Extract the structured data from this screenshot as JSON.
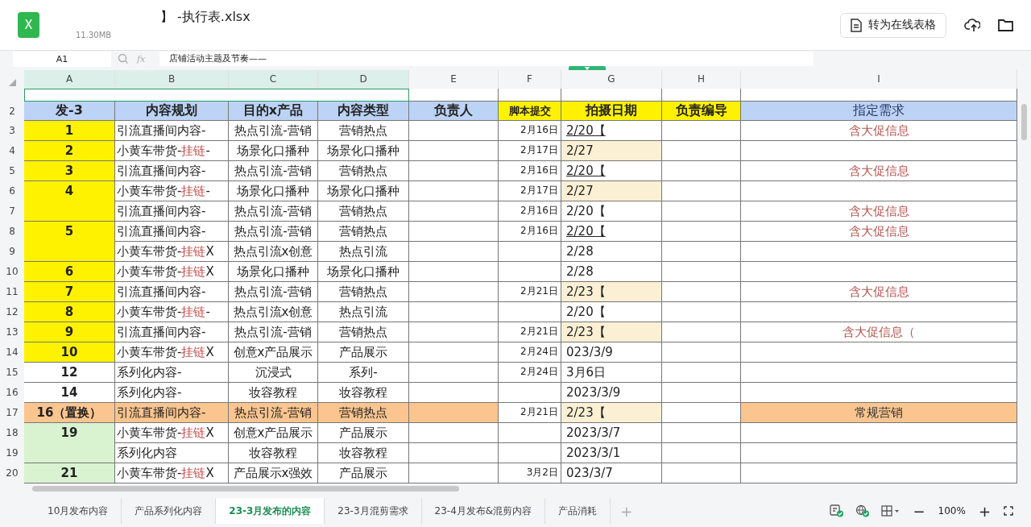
{
  "app_icon_letter": "X",
  "file": {
    "title": "】 -执行表.xlsx",
    "size": "11.30MB"
  },
  "actions": {
    "convert_button": "转为在线表格"
  },
  "formula_bar": {
    "cell_ref": "A1",
    "fx": "fx",
    "formula": "店铺活动主题及节奏——"
  },
  "columns": [
    "A",
    "B",
    "C",
    "D",
    "E",
    "F",
    "G",
    "H",
    "I"
  ],
  "header_row": {
    "number": "2",
    "cells": [
      {
        "text": "发-3",
        "color": "#bcd3f5"
      },
      {
        "text": "内容规划",
        "color": "#bcd3f5"
      },
      {
        "text": "目的x产品",
        "color": "#bcd3f5"
      },
      {
        "text": "内容类型",
        "color": "#bcd3f5"
      },
      {
        "text": "负责人",
        "color": "#bcd3f5"
      },
      {
        "text": "脚本提交",
        "color": "#fff200"
      },
      {
        "text": "拍摄日期",
        "color": "#fff200"
      },
      {
        "text": "负责编导",
        "color": "#fff200"
      },
      {
        "text": "指定需求",
        "color": "#bcd3f5"
      }
    ]
  },
  "rows": [
    {
      "number": "3",
      "a": "1",
      "color": "#fff200",
      "merged": false,
      "b": "引流直播间内容-",
      "c": "热点引流-营销",
      "d": "营销热点",
      "f": "2月16日",
      "g": "2/20【",
      "underlined": true,
      "highlighted": false,
      "i": "含大促信息"
    },
    {
      "number": "4",
      "a": "2",
      "color": "#fff200",
      "merged": false,
      "b": "小黄车带货-",
      "b_link": "挂链",
      "b_end": "-",
      "c": "场景化口播种",
      "d": "场景化口播种",
      "f": "2月17日",
      "g": "2/27",
      "underlined": false,
      "highlighted": true
    },
    {
      "number": "5",
      "a": "3",
      "color": "#fff200",
      "merged": false,
      "b": "引流直播间内容-",
      "c": "热点引流-营销",
      "d": "营销热点",
      "f": "2月16日",
      "g": "2/20【",
      "underlined": true,
      "highlighted": false,
      "i": "含大促信息"
    },
    {
      "number": "6",
      "a": "4",
      "color": "#fff200",
      "merged": true,
      "b": "小黄车带货-",
      "b_link": "挂链",
      "b_end": "-",
      "c": "场景化口播种",
      "d": "场景化口播种",
      "f": "2月17日",
      "g": "2/27",
      "underlined": false,
      "highlighted": true
    },
    {
      "number": "7",
      "b": "引流直播间内容-",
      "c": "热点引流-营销",
      "d": "营销热点",
      "f": "2月16日",
      "g": "2/20【",
      "underlined": false,
      "highlighted": false,
      "i": "含大促信息"
    },
    {
      "number": "8",
      "a": "5",
      "color": "#fff200",
      "merged": true,
      "b": "引流直播间内容-",
      "c": "热点引流-营销",
      "d": "营销热点",
      "f": "2月16日",
      "g": "2/20【",
      "underlined": true,
      "highlighted": false,
      "i": "含大促信息"
    },
    {
      "number": "9",
      "b": "小黄车带货-",
      "b_link": "挂链",
      "b_end": "X",
      "c": "热点引流x创意",
      "d": "热点引流",
      "g": "2/28",
      "underlined": false,
      "highlighted": false
    },
    {
      "number": "10",
      "a": "6",
      "color": "#fff200",
      "merged": false,
      "b": "小黄车带货-",
      "b_link": "挂链",
      "b_end": "X",
      "c": "场景化口播种",
      "d": "场景化口播种",
      "g": "2/28",
      "underlined": false,
      "highlighted": false
    },
    {
      "number": "11",
      "a": "7",
      "color": "#fff200",
      "merged": false,
      "b": "引流直播间内容-",
      "c": "热点引流-营销",
      "d": "营销热点",
      "f": "2月21日",
      "g": "2/23【",
      "underlined": false,
      "highlighted": true,
      "i": "含大促信息"
    },
    {
      "number": "12",
      "a": "8",
      "color": "#fff200",
      "merged": false,
      "b": "小黄车带货-",
      "b_link": "挂链",
      "b_end": "-",
      "c": "热点引流x创意",
      "d": "热点引流",
      "g": "2/20【",
      "underlined": false,
      "highlighted": false
    },
    {
      "number": "13",
      "a": "9",
      "color": "#fff200",
      "merged": false,
      "b": "引流直播间内容-",
      "c": "热点引流-营销",
      "d": "营销热点",
      "f": "2月21日",
      "g": "2/23【",
      "underlined": false,
      "highlighted": true,
      "i": "含大促信息（"
    },
    {
      "number": "14",
      "a": "10",
      "color": "#fff200",
      "merged": false,
      "b": "小黄车带货-",
      "b_link": "挂链",
      "b_end": "X",
      "c": "创意x产品展示",
      "d": "产品展示",
      "f": "2月24日",
      "g": "023/3/9",
      "underlined": false,
      "highlighted": false
    },
    {
      "number": "15",
      "a": "12",
      "color": "#ffffff",
      "merged": false,
      "b": "系列化内容-",
      "c": "沉浸式",
      "d": "系列-",
      "f": "2月24日",
      "g": "3月6日",
      "underlined": false,
      "highlighted": false
    },
    {
      "number": "16",
      "a": "14",
      "color": "#ffffff",
      "merged": false,
      "b": "系列化内容-",
      "c": "妆容教程",
      "d": "妆容教程",
      "g": "2023/3/9",
      "underlined": false,
      "highlighted": false
    },
    {
      "number": "17",
      "a": "16（置换）",
      "color": "#fbc58f",
      "whole_row": true,
      "merged": false,
      "b": "引流直播间内容-",
      "c": "热点引流-营销",
      "d": "营销热点",
      "f": "2月21日",
      "g": "2/23【",
      "underlined": false,
      "highlighted": true,
      "i": "常规营销"
    },
    {
      "number": "18",
      "a": "19",
      "color": "#d9f3d0",
      "merged": true,
      "b": "小黄车带货-",
      "b_link": "挂链",
      "b_end": "X",
      "c": "创意x产品展示",
      "d": "产品展示",
      "g": "2023/3/7",
      "underlined": false,
      "highlighted": false
    },
    {
      "number": "19",
      "b": "系列化内容",
      "c": "妆容教程",
      "d": "妆容教程",
      "g": "2023/3/1",
      "underlined": false,
      "highlighted": false
    },
    {
      "number": "20",
      "a": "21",
      "color": "#d9f3d0",
      "b": "小黄车带货-",
      "b_link": "挂链",
      "b_end": "X",
      "c": "产品展示x强效",
      "d": "产品展示",
      "f": "3月2日",
      "g": "023/3/7",
      "underlined": false,
      "highlighted": false
    }
  ],
  "sheet_tabs": [
    {
      "label": "10月发布内容",
      "selected": false
    },
    {
      "label": "产品系列化内容",
      "selected": false
    },
    {
      "label": "23-3月发布的内容",
      "selected": true
    },
    {
      "label": "23-3月混剪需求",
      "selected": false
    },
    {
      "label": "23-4月发布&混剪内容",
      "selected": false
    },
    {
      "label": "产品消耗",
      "selected": false
    }
  ],
  "add_sheet": "+",
  "zoom": {
    "minus": "−",
    "level": "100%",
    "plus": "+"
  }
}
